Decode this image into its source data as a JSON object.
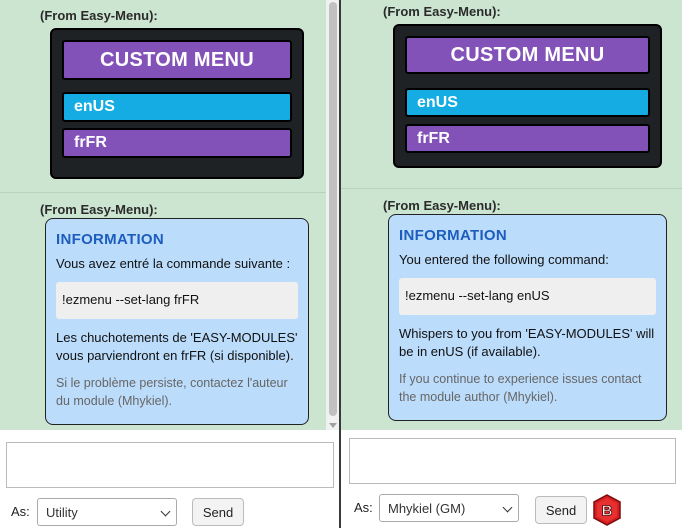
{
  "left": {
    "messages": [
      {
        "from": "(From Easy-Menu):",
        "menu": {
          "title": "CUSTOM MENU",
          "options": [
            "enUS",
            "frFR"
          ]
        }
      },
      {
        "from": "(From Easy-Menu):",
        "info": {
          "title": "INFORMATION",
          "intro": "Vous avez entré la commande suivante :",
          "command": "!ezmenu --set-lang frFR",
          "result": "Les chuchotements de 'EASY-MODULES' vous parviendront en frFR (si disponible).",
          "help": "Si le problème persiste, contactez l'auteur du module (Mhykiel)."
        }
      }
    ],
    "footer": {
      "as_label": "As:",
      "speaker": "Utility",
      "send_label": "Send"
    }
  },
  "right": {
    "messages": [
      {
        "from": "(From Easy-Menu):",
        "menu": {
          "title": "CUSTOM MENU",
          "options": [
            "enUS",
            "frFR"
          ]
        }
      },
      {
        "from": "(From Easy-Menu):",
        "info": {
          "title": "INFORMATION",
          "intro": "You entered the following command:",
          "command": "!ezmenu --set-lang enUS",
          "result": "Whispers to you from 'EASY-MODULES' will be in enUS (if available).",
          "help": "If you continue to experience issues contact the module author (Mhykiel)."
        }
      }
    ],
    "footer": {
      "as_label": "As:",
      "speaker": "Mhykiel (GM)",
      "send_label": "Send",
      "icon": "b-gem-icon"
    }
  },
  "colors": {
    "chat_bg": "#cbe5d1",
    "menu_purple": "#8352b8",
    "menu_blue": "#14ace2",
    "info_bg": "#bcdcfb",
    "info_title": "#1c5dbe",
    "icon_red": "#d61f1f"
  }
}
